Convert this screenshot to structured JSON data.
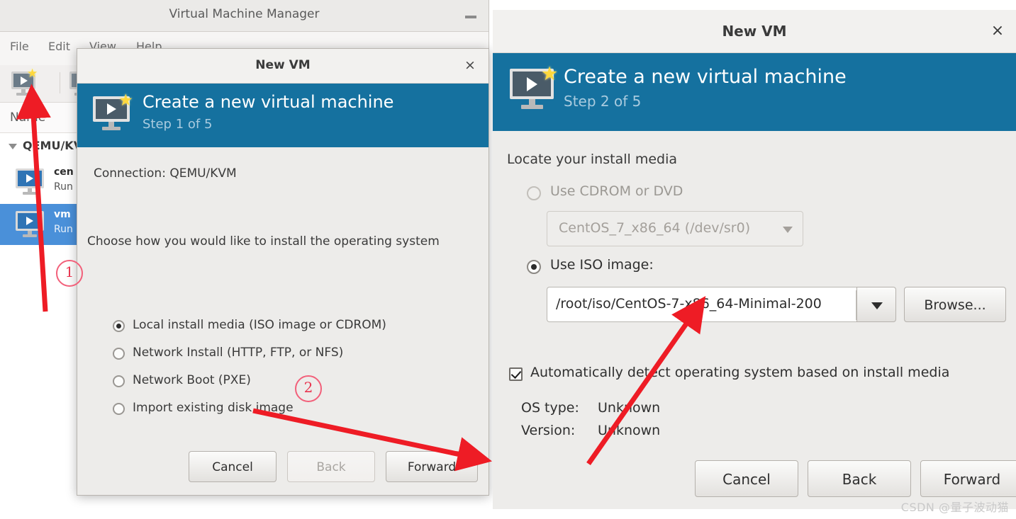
{
  "main_window": {
    "title": "Virtual Machine Manager",
    "minimize_label": "–",
    "menu": [
      "File",
      "Edit",
      "View",
      "Help"
    ],
    "list_header": "Name",
    "connection_node": "QEMU/KVM",
    "vms": [
      {
        "name": "cen",
        "state": "Run",
        "selected": false
      },
      {
        "name": "vm",
        "state": "Run",
        "selected": true
      }
    ]
  },
  "dialog_step1": {
    "title": "New VM",
    "close_label": "×",
    "banner_title": "Create a new virtual machine",
    "banner_step": "Step 1 of 5",
    "connection_label": "Connection:  QEMU/KVM",
    "choose_label": "Choose how you would like to install the operating system",
    "options": [
      {
        "label": "Local install media (ISO image or CDROM)",
        "selected": true
      },
      {
        "label": "Network Install (HTTP, FTP, or NFS)",
        "selected": false
      },
      {
        "label": "Network Boot (PXE)",
        "selected": false
      },
      {
        "label": "Import existing disk image",
        "selected": false
      }
    ],
    "buttons": {
      "cancel": "Cancel",
      "back": "Back",
      "forward": "Forward",
      "back_disabled": true
    }
  },
  "dialog_step2": {
    "title": "New VM",
    "close_label": "×",
    "banner_title": "Create a new virtual machine",
    "banner_step": "Step 2 of 5",
    "section_label": "Locate your install media",
    "cdrom_option": {
      "label": "Use CDROM or DVD",
      "selected": false,
      "disabled": true,
      "device_value": "CentOS_7_x86_64 (/dev/sr0)"
    },
    "iso_option": {
      "label": "Use ISO image:",
      "selected": true,
      "path_value": "/root/iso/CentOS-7-x86_64-Minimal-200",
      "browse_label": "Browse..."
    },
    "autodetect": {
      "label": "Automatically detect operating system based on install media",
      "checked": true
    },
    "os_type_key": "OS type:",
    "os_type_value": "Unknown",
    "version_key": "Version:",
    "version_value": "Unknown",
    "buttons": {
      "cancel": "Cancel",
      "back": "Back",
      "forward": "Forward"
    }
  },
  "annotations": {
    "marker_one": "①",
    "marker_two": "②",
    "one_text": "1",
    "two_text": "2"
  },
  "watermark": "CSDN @量子波动猫",
  "colors": {
    "banner_blue": "#15719f",
    "selection_blue": "#4a90d9",
    "annotation_red": "#e8344f",
    "dialog_bg": "#edecea"
  }
}
